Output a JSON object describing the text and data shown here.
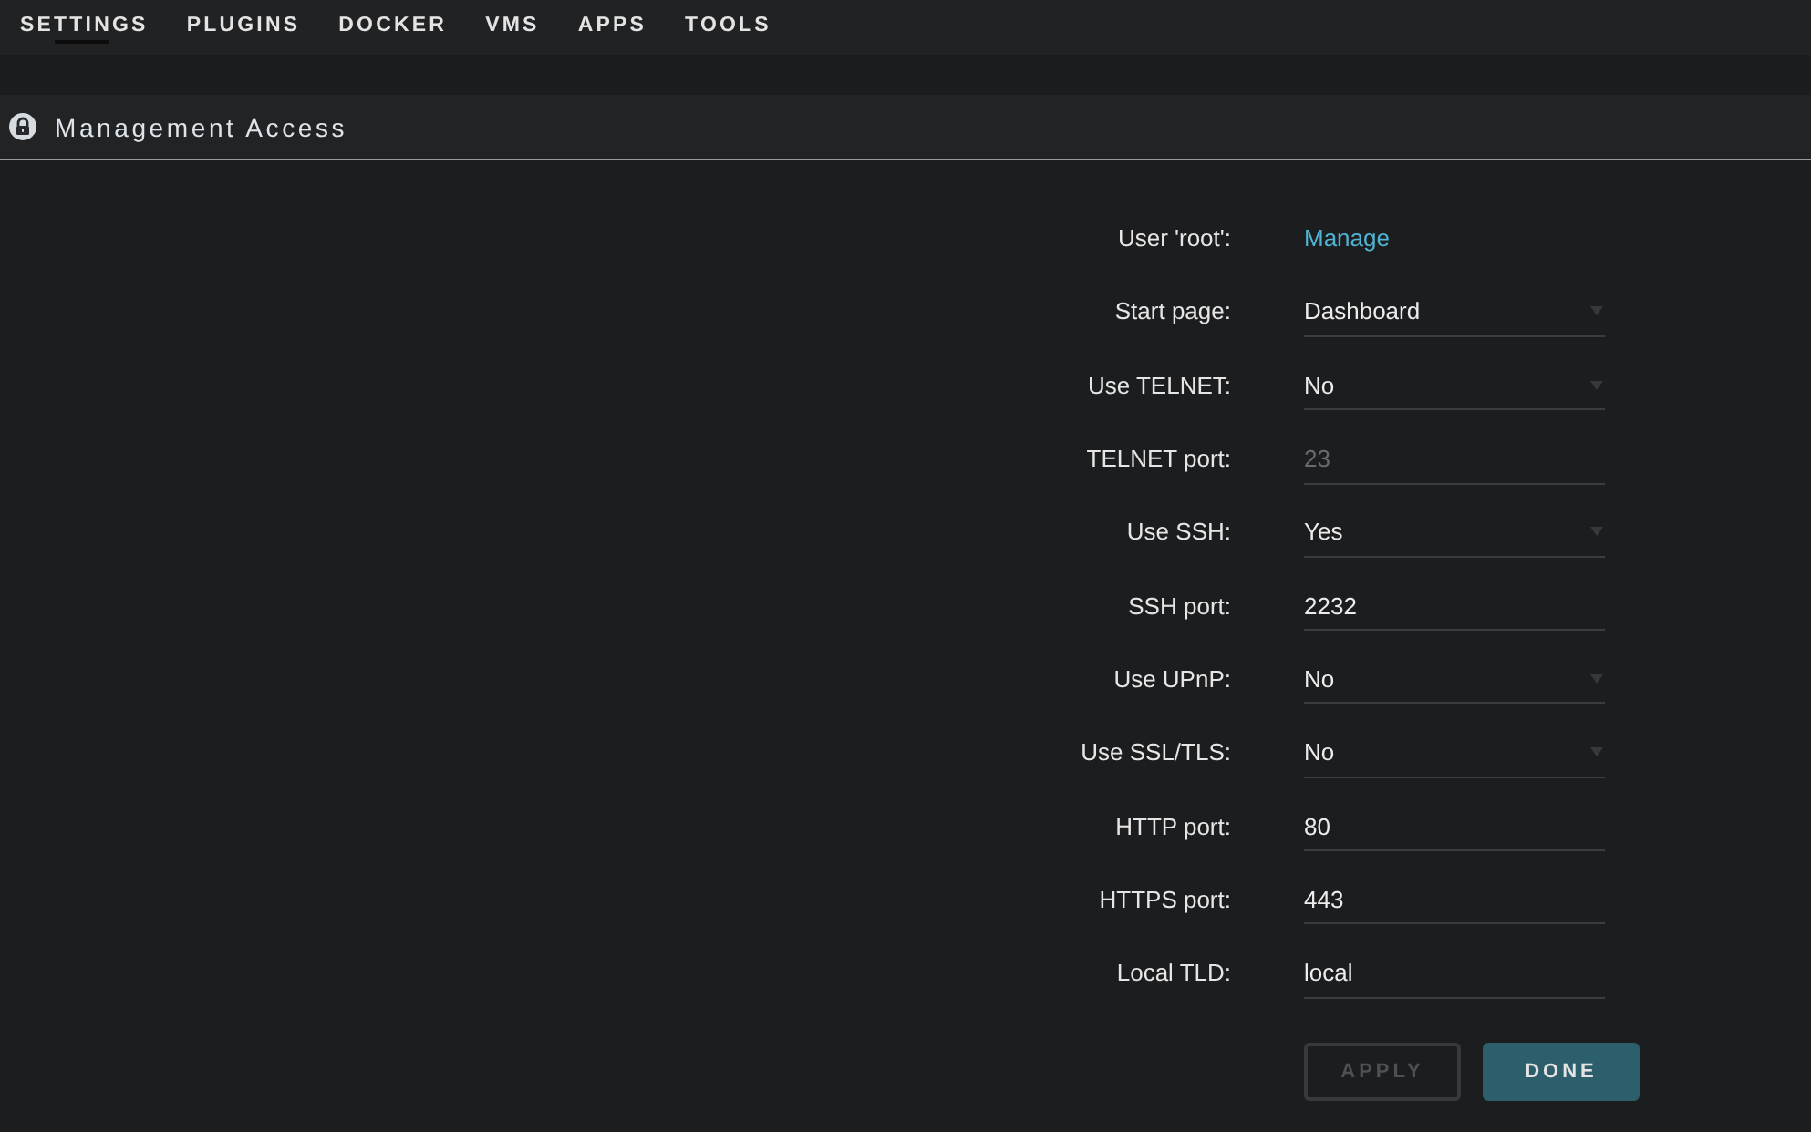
{
  "nav": {
    "tabs": [
      {
        "label": "SETTINGS",
        "selected": true
      },
      {
        "label": "PLUGINS",
        "selected": false
      },
      {
        "label": "DOCKER",
        "selected": false
      },
      {
        "label": "VMS",
        "selected": false
      },
      {
        "label": "APPS",
        "selected": false
      },
      {
        "label": "TOOLS",
        "selected": false
      }
    ]
  },
  "section": {
    "title": "Management Access"
  },
  "form": {
    "rows": [
      {
        "label": "User 'root':",
        "kind": "link",
        "value": "Manage",
        "disabled": false
      },
      {
        "label": "Start page:",
        "kind": "select",
        "value": "Dashboard",
        "disabled": false
      },
      {
        "label": "Use TELNET:",
        "kind": "select",
        "value": "No",
        "disabled": false
      },
      {
        "label": "TELNET port:",
        "kind": "input",
        "value": "23",
        "disabled": true
      },
      {
        "label": "Use SSH:",
        "kind": "select",
        "value": "Yes",
        "disabled": false
      },
      {
        "label": "SSH port:",
        "kind": "input",
        "value": "2232",
        "disabled": false
      },
      {
        "label": "Use UPnP:",
        "kind": "select",
        "value": "No",
        "disabled": false
      },
      {
        "label": "Use SSL/TLS:",
        "kind": "select",
        "value": "No",
        "disabled": false
      },
      {
        "label": "HTTP port:",
        "kind": "input",
        "value": "80",
        "disabled": false
      },
      {
        "label": "HTTPS port:",
        "kind": "input",
        "value": "443",
        "disabled": false
      },
      {
        "label": "Local TLD:",
        "kind": "input",
        "value": "local",
        "disabled": false
      }
    ]
  },
  "buttons": [
    {
      "label": "APPLY",
      "disabled": true
    },
    {
      "label": "DONE",
      "disabled": false
    }
  ]
}
